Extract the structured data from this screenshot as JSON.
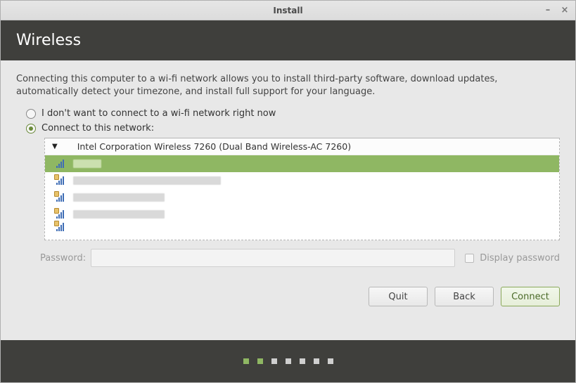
{
  "titlebar": {
    "title": "Install"
  },
  "header": {
    "page_title": "Wireless"
  },
  "description": "Connecting this computer to a wi-fi network allows you to install third-party software, download updates, automatically detect your timezone, and install full support for your language.",
  "options": {
    "skip": "I don't want to connect to a wi-fi network right now",
    "connect": "Connect to this network:",
    "selected": "connect"
  },
  "device": "Intel Corporation Wireless 7260 (Dual Band Wireless-AC 7260)",
  "networks": [
    {
      "secured": false,
      "selected": true,
      "blur_width": 40
    },
    {
      "secured": true,
      "selected": false,
      "blur_width": 210
    },
    {
      "secured": true,
      "selected": false,
      "blur_width": 130
    },
    {
      "secured": true,
      "selected": false,
      "blur_width": 130
    }
  ],
  "password": {
    "label": "Password:",
    "value": "",
    "display_label": "Display password",
    "display_checked": false
  },
  "buttons": {
    "quit": "Quit",
    "back": "Back",
    "connect": "Connect"
  },
  "progress": {
    "total": 7,
    "done": 2
  }
}
